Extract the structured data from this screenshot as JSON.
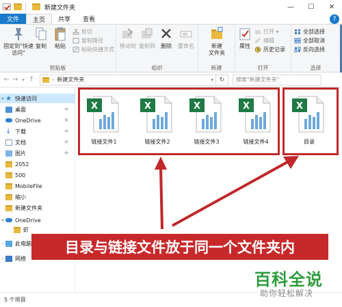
{
  "window": {
    "title": "新建文件夹",
    "minimize": "—",
    "maximize": "☐",
    "close": "✕"
  },
  "ribbon_tabs": [
    "文件",
    "主页",
    "共享",
    "查看"
  ],
  "help": "?",
  "ribbon": {
    "clipboard": {
      "label": "剪贴板",
      "pin": "固定到\"快速访问\"",
      "copy": "复制",
      "paste": "粘贴",
      "cut": "剪切",
      "copy_path": "复制路径",
      "paste_shortcut": "粘贴快捷方式"
    },
    "organize": {
      "label": "组织",
      "move_to": "移动到",
      "copy_to": "复制到",
      "delete": "删除",
      "rename": "重命名"
    },
    "new": {
      "label": "新建",
      "new_folder": "新建\n文件夹"
    },
    "open": {
      "label": "打开",
      "properties": "属性",
      "open": "打开 ▾",
      "edit": "编辑",
      "history": "历史记录"
    },
    "select": {
      "label": "选择",
      "select_all": "全部选择",
      "select_none": "全部取消",
      "invert": "反向选择"
    }
  },
  "address": {
    "path": "新建文件夹",
    "search_placeholder": "搜索\"新建文件夹\""
  },
  "nav": [
    {
      "label": "快速访问",
      "icon": "star-icon",
      "pinned": false
    },
    {
      "label": "桌面",
      "icon": "desktop-icon",
      "pinned": true
    },
    {
      "label": "OneDrive",
      "icon": "onedrive-icon",
      "pinned": true
    },
    {
      "label": "下载",
      "icon": "download-icon",
      "pinned": true
    },
    {
      "label": "文档",
      "icon": "documents-icon",
      "pinned": true
    },
    {
      "label": "图片",
      "icon": "pictures-icon",
      "pinned": true
    },
    {
      "label": "2052",
      "icon": "folder-icon",
      "pinned": false
    },
    {
      "label": "500",
      "icon": "folder-icon",
      "pinned": false
    },
    {
      "label": "MobileFile",
      "icon": "folder-icon",
      "pinned": false
    },
    {
      "label": "缩小",
      "icon": "folder-icon",
      "pinned": false
    },
    {
      "label": "新建文件夹",
      "icon": "folder-icon",
      "pinned": false
    },
    {
      "label": "OneDrive",
      "icon": "onedrive-icon",
      "pinned": false
    },
    {
      "label": "虾",
      "icon": "folder-icon",
      "pinned": false
    },
    {
      "label": "此电脑",
      "icon": "pc-icon",
      "pinned": false
    },
    {
      "label": "网络",
      "icon": "network-icon",
      "pinned": false
    }
  ],
  "pin_glyph": "📌",
  "files": [
    {
      "label": "链接文件1"
    },
    {
      "label": "链接文件2"
    },
    {
      "label": "链接文件3"
    },
    {
      "label": "链接文件4"
    },
    {
      "label": "目录"
    }
  ],
  "status": "5 个项目",
  "annotation": {
    "banner": "目录与链接文件放于同一个文件夹内",
    "color": "#c7292b"
  },
  "watermark": {
    "main": "百科全说",
    "sub": "助你轻松解决"
  }
}
